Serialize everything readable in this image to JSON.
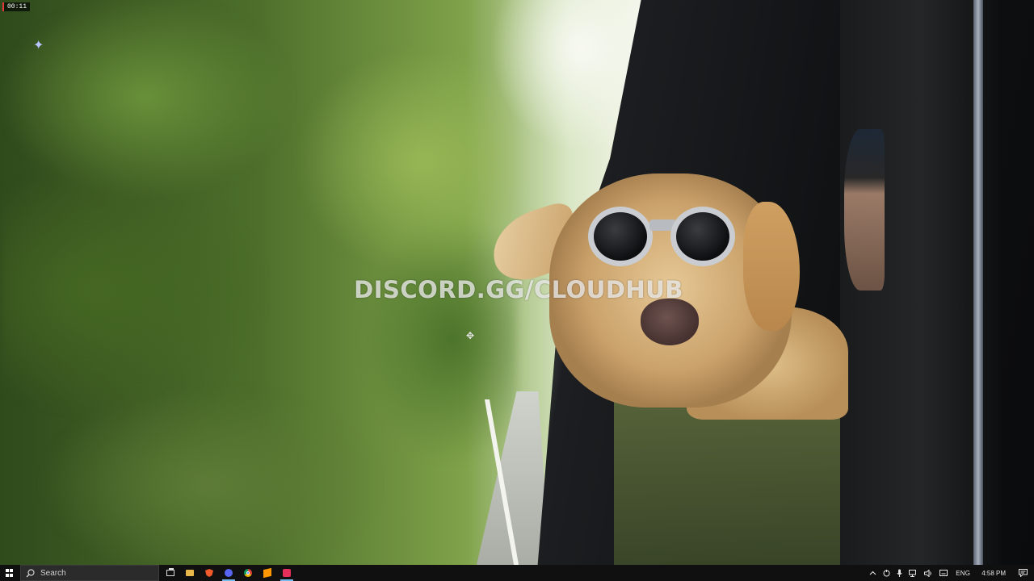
{
  "recording": {
    "timer": "00:11"
  },
  "wallpaper": {
    "overlay_text": "DISCORD.GG/CLOUDHUB",
    "description_icons": [
      "sparkle-cursor",
      "move-cursor"
    ]
  },
  "taskbar": {
    "search_placeholder": "Search",
    "pinned_apps": [
      {
        "name": "task-view",
        "icon": "task-view-icon"
      },
      {
        "name": "file-explorer",
        "icon": "folder-icon"
      },
      {
        "name": "brave",
        "icon": "brave-icon"
      },
      {
        "name": "discord",
        "icon": "discord-icon"
      },
      {
        "name": "chrome",
        "icon": "chrome-icon"
      },
      {
        "name": "sublime",
        "icon": "sublime-icon"
      },
      {
        "name": "app-red",
        "icon": "red-app-icon"
      }
    ],
    "tray": {
      "language": "ENG",
      "time": "4:58 PM"
    }
  },
  "colors": {
    "taskbar_bg": "#101010",
    "active_indicator": "#76b9ed",
    "timer_accent": "#e23a3a"
  }
}
